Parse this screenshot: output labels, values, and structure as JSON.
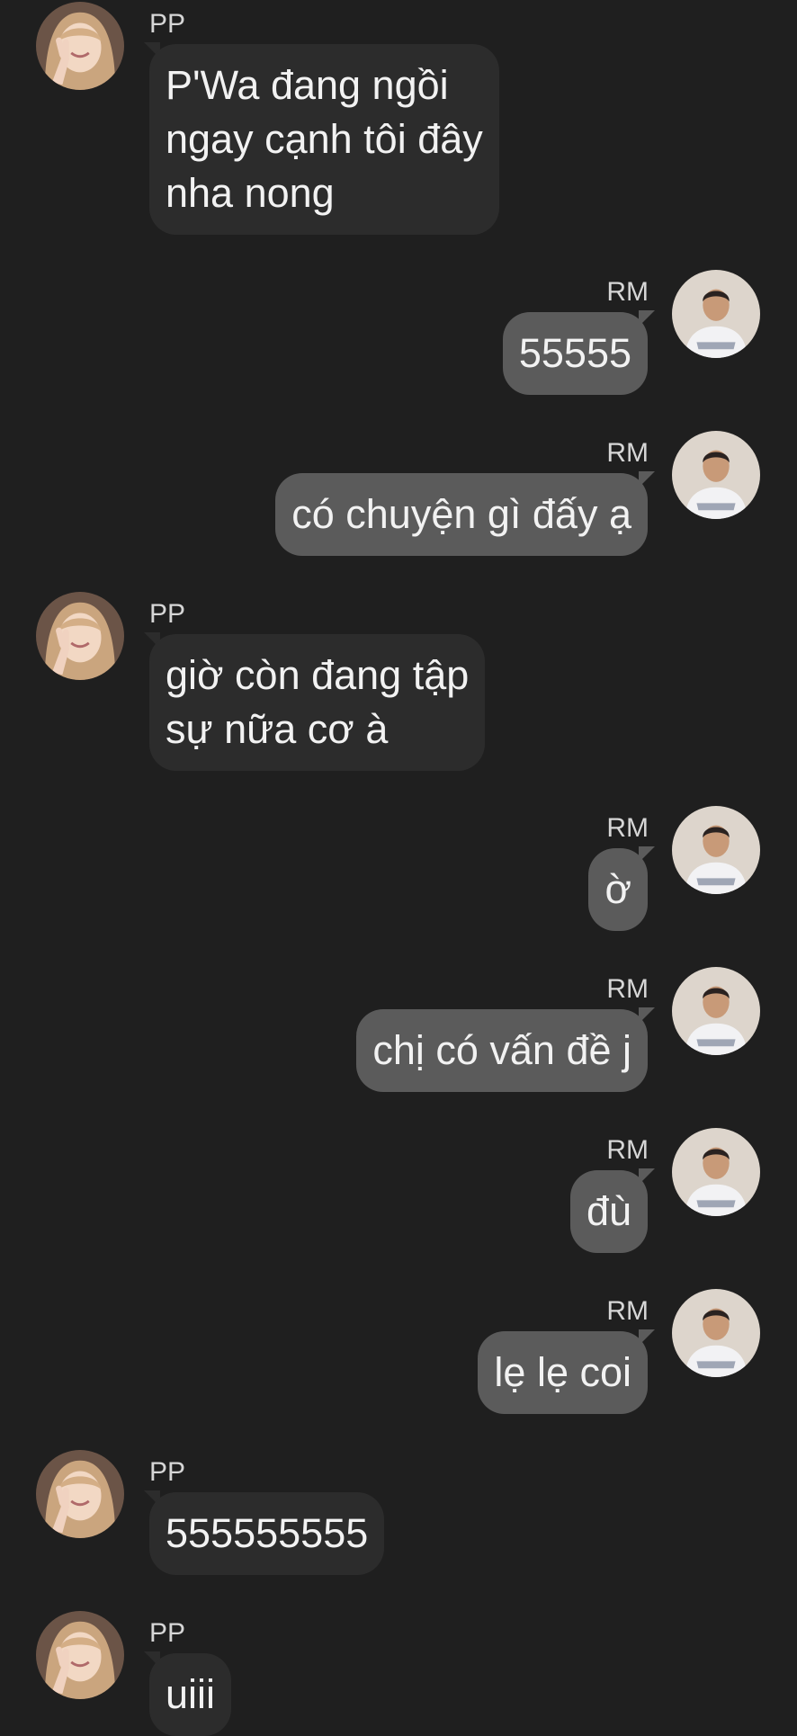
{
  "messages": [
    {
      "sender": "PP",
      "text": "P'Wa đang ngồi\nngay cạnh tôi đây\nnha nong"
    },
    {
      "sender": "RM",
      "text": "55555"
    },
    {
      "sender": "RM",
      "text": "có chuyện gì đấy ạ"
    },
    {
      "sender": "PP",
      "text": "giờ còn đang tập\nsự nữa cơ à"
    },
    {
      "sender": "RM",
      "text": "ờ"
    },
    {
      "sender": "RM",
      "text": "chị có vấn đề j"
    },
    {
      "sender": "RM",
      "text": "đù"
    },
    {
      "sender": "RM",
      "text": "lẹ lẹ coi"
    },
    {
      "sender": "PP",
      "text": "555555555"
    },
    {
      "sender": "PP",
      "text": "uiii"
    }
  ],
  "avatars": {
    "PP": "girl-avatar-icon",
    "RM": "boy-avatar-icon"
  },
  "colors": {
    "background": "#1f1f1f",
    "incoming_bubble": "#2c2c2c",
    "outgoing_bubble": "#5b5b5b",
    "text": "#f2f2f2",
    "sender_name": "#d6d6d6"
  }
}
